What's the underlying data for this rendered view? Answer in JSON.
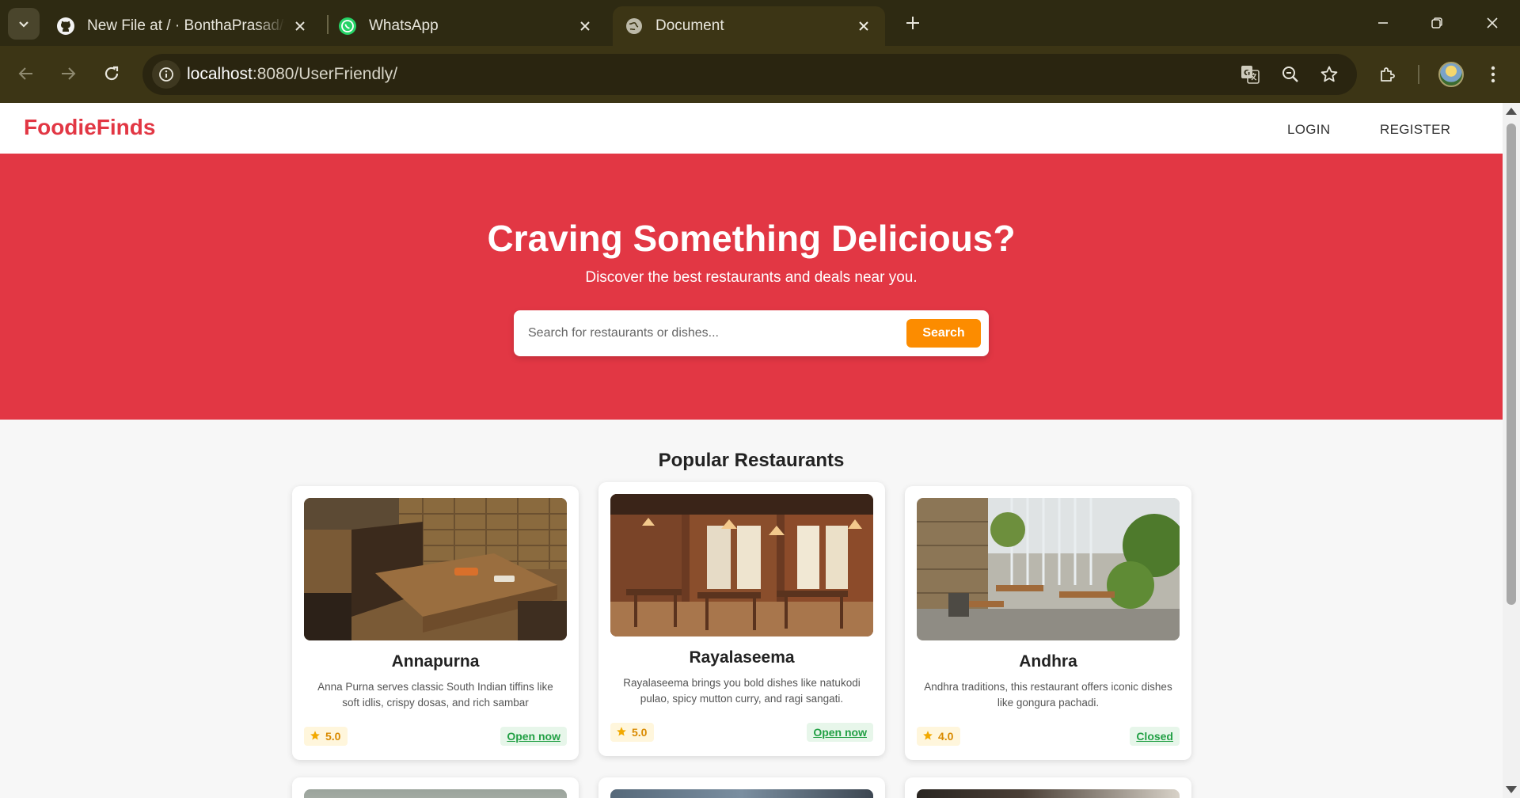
{
  "browser": {
    "tabs": [
      {
        "title": "New File at / · BonthaPrasad/fo",
        "icon": "github-icon"
      },
      {
        "title": "WhatsApp",
        "icon": "whatsapp-icon"
      },
      {
        "title": "Document",
        "icon": "globe-icon",
        "active": true
      }
    ],
    "address": {
      "host": "localhost",
      "rest": ":8080/UserFriendly/"
    }
  },
  "site": {
    "brand": "FoodieFinds",
    "nav": {
      "login": "LOGIN",
      "register": "REGISTER"
    }
  },
  "hero": {
    "title": "Craving Something Delicious?",
    "subtitle": "Discover the best restaurants and deals near you.",
    "search_placeholder": "Search for restaurants or dishes...",
    "search_button": "Search"
  },
  "section": {
    "title": "Popular Restaurants"
  },
  "restaurants": [
    {
      "name": "Annapurna",
      "description": "Anna Purna serves classic South Indian tiffins like soft idlis, crispy dosas, and rich sambar",
      "rating": "5.0",
      "status": "Open now"
    },
    {
      "name": "Rayalaseema",
      "description": "Rayalaseema brings you bold dishes like natukodi pulao, spicy mutton curry, and ragi sangati.",
      "rating": "5.0",
      "status": "Open now"
    },
    {
      "name": "Andhra",
      "description": "Andhra traditions, this restaurant offers iconic dishes like gongura pachadi.",
      "rating": "4.0",
      "status": "Closed"
    }
  ],
  "colors": {
    "brand_red": "#e23744",
    "search_orange": "#fc8c00",
    "status_green": "#22a045",
    "rating_amber": "#d98a00"
  }
}
